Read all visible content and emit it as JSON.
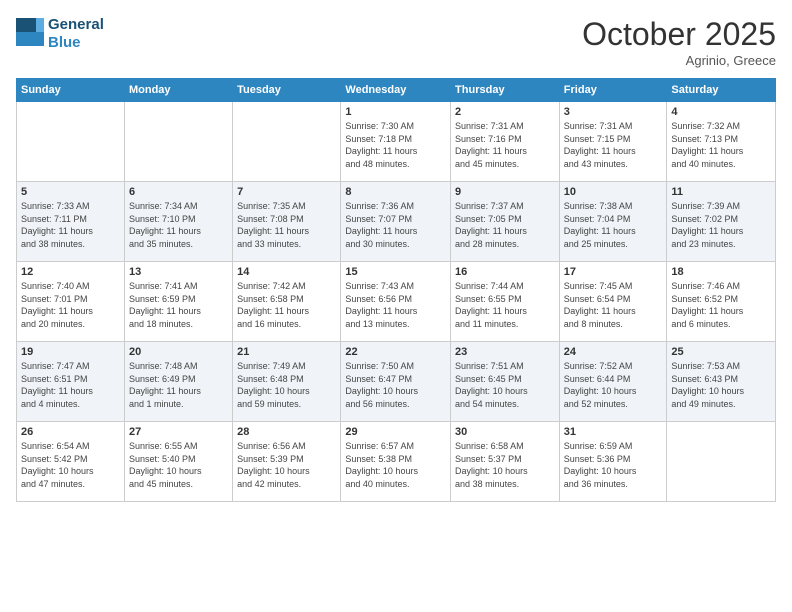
{
  "header": {
    "logo_line1": "General",
    "logo_line2": "Blue",
    "month": "October 2025",
    "location": "Agrinio, Greece"
  },
  "weekdays": [
    "Sunday",
    "Monday",
    "Tuesday",
    "Wednesday",
    "Thursday",
    "Friday",
    "Saturday"
  ],
  "weeks": [
    [
      {
        "day": "",
        "info": ""
      },
      {
        "day": "",
        "info": ""
      },
      {
        "day": "",
        "info": ""
      },
      {
        "day": "1",
        "info": "Sunrise: 7:30 AM\nSunset: 7:18 PM\nDaylight: 11 hours\nand 48 minutes."
      },
      {
        "day": "2",
        "info": "Sunrise: 7:31 AM\nSunset: 7:16 PM\nDaylight: 11 hours\nand 45 minutes."
      },
      {
        "day": "3",
        "info": "Sunrise: 7:31 AM\nSunset: 7:15 PM\nDaylight: 11 hours\nand 43 minutes."
      },
      {
        "day": "4",
        "info": "Sunrise: 7:32 AM\nSunset: 7:13 PM\nDaylight: 11 hours\nand 40 minutes."
      }
    ],
    [
      {
        "day": "5",
        "info": "Sunrise: 7:33 AM\nSunset: 7:11 PM\nDaylight: 11 hours\nand 38 minutes."
      },
      {
        "day": "6",
        "info": "Sunrise: 7:34 AM\nSunset: 7:10 PM\nDaylight: 11 hours\nand 35 minutes."
      },
      {
        "day": "7",
        "info": "Sunrise: 7:35 AM\nSunset: 7:08 PM\nDaylight: 11 hours\nand 33 minutes."
      },
      {
        "day": "8",
        "info": "Sunrise: 7:36 AM\nSunset: 7:07 PM\nDaylight: 11 hours\nand 30 minutes."
      },
      {
        "day": "9",
        "info": "Sunrise: 7:37 AM\nSunset: 7:05 PM\nDaylight: 11 hours\nand 28 minutes."
      },
      {
        "day": "10",
        "info": "Sunrise: 7:38 AM\nSunset: 7:04 PM\nDaylight: 11 hours\nand 25 minutes."
      },
      {
        "day": "11",
        "info": "Sunrise: 7:39 AM\nSunset: 7:02 PM\nDaylight: 11 hours\nand 23 minutes."
      }
    ],
    [
      {
        "day": "12",
        "info": "Sunrise: 7:40 AM\nSunset: 7:01 PM\nDaylight: 11 hours\nand 20 minutes."
      },
      {
        "day": "13",
        "info": "Sunrise: 7:41 AM\nSunset: 6:59 PM\nDaylight: 11 hours\nand 18 minutes."
      },
      {
        "day": "14",
        "info": "Sunrise: 7:42 AM\nSunset: 6:58 PM\nDaylight: 11 hours\nand 16 minutes."
      },
      {
        "day": "15",
        "info": "Sunrise: 7:43 AM\nSunset: 6:56 PM\nDaylight: 11 hours\nand 13 minutes."
      },
      {
        "day": "16",
        "info": "Sunrise: 7:44 AM\nSunset: 6:55 PM\nDaylight: 11 hours\nand 11 minutes."
      },
      {
        "day": "17",
        "info": "Sunrise: 7:45 AM\nSunset: 6:54 PM\nDaylight: 11 hours\nand 8 minutes."
      },
      {
        "day": "18",
        "info": "Sunrise: 7:46 AM\nSunset: 6:52 PM\nDaylight: 11 hours\nand 6 minutes."
      }
    ],
    [
      {
        "day": "19",
        "info": "Sunrise: 7:47 AM\nSunset: 6:51 PM\nDaylight: 11 hours\nand 4 minutes."
      },
      {
        "day": "20",
        "info": "Sunrise: 7:48 AM\nSunset: 6:49 PM\nDaylight: 11 hours\nand 1 minute."
      },
      {
        "day": "21",
        "info": "Sunrise: 7:49 AM\nSunset: 6:48 PM\nDaylight: 10 hours\nand 59 minutes."
      },
      {
        "day": "22",
        "info": "Sunrise: 7:50 AM\nSunset: 6:47 PM\nDaylight: 10 hours\nand 56 minutes."
      },
      {
        "day": "23",
        "info": "Sunrise: 7:51 AM\nSunset: 6:45 PM\nDaylight: 10 hours\nand 54 minutes."
      },
      {
        "day": "24",
        "info": "Sunrise: 7:52 AM\nSunset: 6:44 PM\nDaylight: 10 hours\nand 52 minutes."
      },
      {
        "day": "25",
        "info": "Sunrise: 7:53 AM\nSunset: 6:43 PM\nDaylight: 10 hours\nand 49 minutes."
      }
    ],
    [
      {
        "day": "26",
        "info": "Sunrise: 6:54 AM\nSunset: 5:42 PM\nDaylight: 10 hours\nand 47 minutes."
      },
      {
        "day": "27",
        "info": "Sunrise: 6:55 AM\nSunset: 5:40 PM\nDaylight: 10 hours\nand 45 minutes."
      },
      {
        "day": "28",
        "info": "Sunrise: 6:56 AM\nSunset: 5:39 PM\nDaylight: 10 hours\nand 42 minutes."
      },
      {
        "day": "29",
        "info": "Sunrise: 6:57 AM\nSunset: 5:38 PM\nDaylight: 10 hours\nand 40 minutes."
      },
      {
        "day": "30",
        "info": "Sunrise: 6:58 AM\nSunset: 5:37 PM\nDaylight: 10 hours\nand 38 minutes."
      },
      {
        "day": "31",
        "info": "Sunrise: 6:59 AM\nSunset: 5:36 PM\nDaylight: 10 hours\nand 36 minutes."
      },
      {
        "day": "",
        "info": ""
      }
    ]
  ]
}
